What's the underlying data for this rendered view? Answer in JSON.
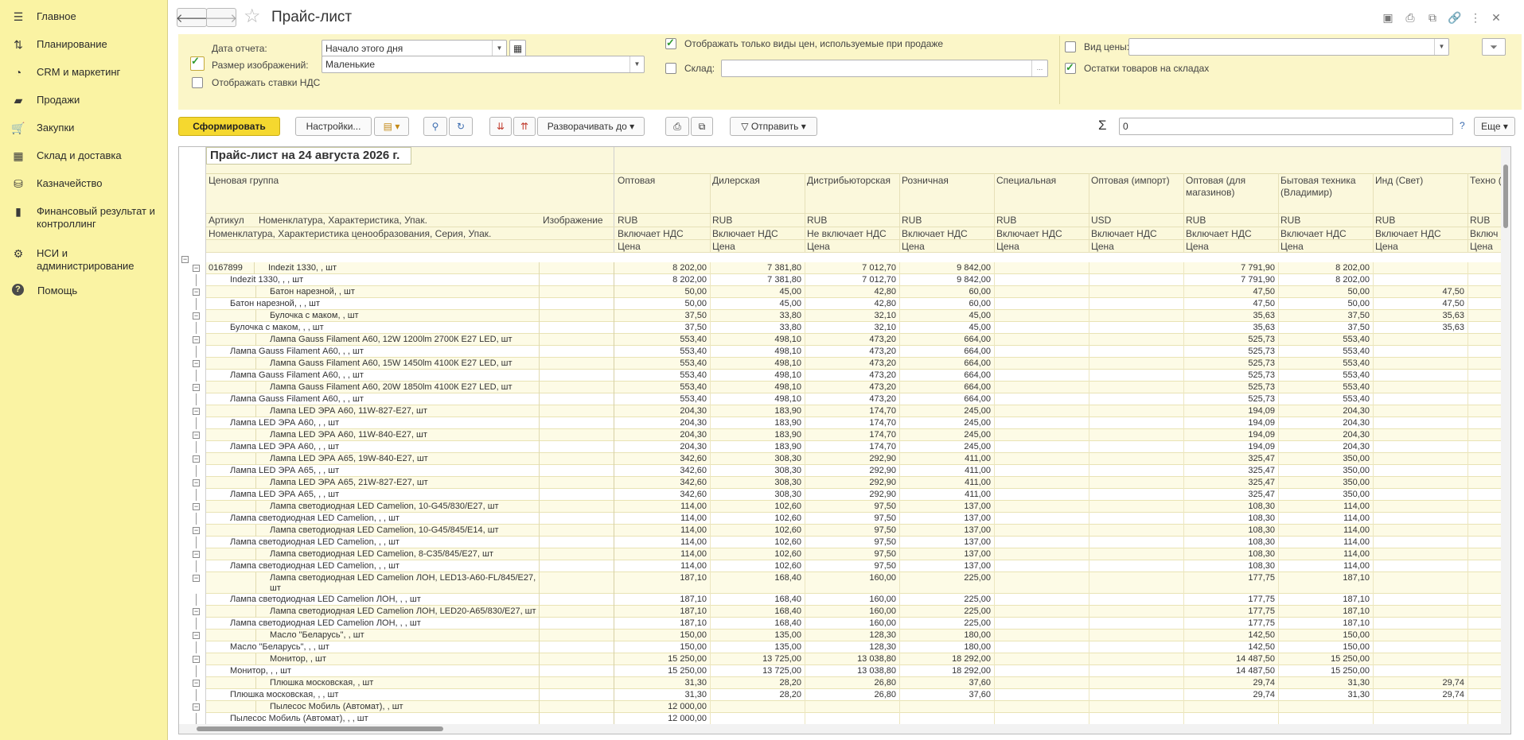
{
  "sidebar": {
    "items": [
      {
        "label": "Главное",
        "icon": "menu-icon"
      },
      {
        "label": "Планирование",
        "icon": "planning-icon"
      },
      {
        "label": "CRM и маркетинг",
        "icon": "crm-icon"
      },
      {
        "label": "Продажи",
        "icon": "bag-icon"
      },
      {
        "label": "Закупки",
        "icon": "cart-icon"
      },
      {
        "label": "Склад и доставка",
        "icon": "warehouse-icon"
      },
      {
        "label": "Казначейство",
        "icon": "treasury-icon"
      },
      {
        "label": "Финансовый результат и контроллинг",
        "icon": "chart-icon"
      },
      {
        "label": "НСИ и администрирование",
        "icon": "gear-icon"
      },
      {
        "label": "Помощь",
        "icon": "help-icon"
      }
    ]
  },
  "header": {
    "title": "Прайс-лист"
  },
  "filters": {
    "report_date_label": "Дата отчета:",
    "report_date_value": "Начало этого дня",
    "image_size_label": "Размер изображений:",
    "image_size_value": "Маленькие",
    "show_vat_label": "Отображать ставки НДС",
    "only_sale_prices_label": "Отображать только виды цен, используемые при продаже",
    "warehouse_label": "Склад:",
    "warehouse_value": "",
    "price_type_label": "Вид цены:",
    "price_type_value": "",
    "stock_label": "Остатки товаров на складах"
  },
  "toolbar": {
    "generate": "Сформировать",
    "settings": "Настройки...",
    "expand": "Разворачивать до",
    "send": "Отправить",
    "sum_value": "0",
    "help": "?",
    "more": "Еще"
  },
  "report": {
    "title": "Прайс-лист на 24 августа 2026 г.",
    "price_group_header": "Ценовая группа",
    "col_article": "Артикул",
    "col_nomenclature": "Номенклатура, Характеристика, Упак.",
    "col_image": "Изображение",
    "col_nomenclature2": "Номенклатура, Характеристика ценообразования, Серия, Упак.",
    "price_columns": [
      {
        "name": "Оптовая",
        "currency": "RUB",
        "vat": "Включает НДС",
        "kind": "Цена"
      },
      {
        "name": "Дилерская",
        "currency": "RUB",
        "vat": "Включает НДС",
        "kind": "Цена"
      },
      {
        "name": "Дистрибьюторская",
        "currency": "RUB",
        "vat": "Не включает НДС",
        "kind": "Цена"
      },
      {
        "name": "Розничная",
        "currency": "RUB",
        "vat": "Включает НДС",
        "kind": "Цена"
      },
      {
        "name": "Специальная",
        "currency": "RUB",
        "vat": "Включает НДС",
        "kind": "Цена"
      },
      {
        "name": "Оптовая (импорт)",
        "currency": "USD",
        "vat": "Включает НДС",
        "kind": "Цена"
      },
      {
        "name": "Оптовая (для магазинов)",
        "currency": "RUB",
        "vat": "Включает НДС",
        "kind": "Цена"
      },
      {
        "name": "Бытовая техника (Владимир)",
        "currency": "RUB",
        "vat": "Включает НДС",
        "kind": "Цена"
      },
      {
        "name": "Инд (Свет)",
        "currency": "RUB",
        "vat": "Включает НДС",
        "kind": "Цена"
      },
      {
        "name": "Техно (инди",
        "currency": "RUB",
        "vat": "Включ",
        "kind": "Цена"
      }
    ],
    "rows": [
      {
        "art": "0167899",
        "name": "Indezit 1330, , шт",
        "lvl": 1,
        "v": [
          "8 202,00",
          "7 381,80",
          "7 012,70",
          "9 842,00",
          "",
          "",
          "7 791,90",
          "8 202,00",
          "",
          ""
        ]
      },
      {
        "art": "",
        "name": "Indezit 1330, , , шт",
        "lvl": 0,
        "v": [
          "8 202,00",
          "7 381,80",
          "7 012,70",
          "9 842,00",
          "",
          "",
          "7 791,90",
          "8 202,00",
          "",
          ""
        ]
      },
      {
        "art": "",
        "name": "Батон нарезной, , шт",
        "lvl": 2,
        "v": [
          "50,00",
          "45,00",
          "42,80",
          "60,00",
          "",
          "",
          "47,50",
          "50,00",
          "47,50",
          ""
        ]
      },
      {
        "art": "",
        "name": "Батон нарезной, , , шт",
        "lvl": 0,
        "v": [
          "50,00",
          "45,00",
          "42,80",
          "60,00",
          "",
          "",
          "47,50",
          "50,00",
          "47,50",
          ""
        ]
      },
      {
        "art": "",
        "name": "Булочка с маком, , шт",
        "lvl": 2,
        "v": [
          "37,50",
          "33,80",
          "32,10",
          "45,00",
          "",
          "",
          "35,63",
          "37,50",
          "35,63",
          ""
        ]
      },
      {
        "art": "",
        "name": "Булочка с маком, , , шт",
        "lvl": 0,
        "v": [
          "37,50",
          "33,80",
          "32,10",
          "45,00",
          "",
          "",
          "35,63",
          "37,50",
          "35,63",
          ""
        ]
      },
      {
        "art": "",
        "name": "Лампа Gauss Filament А60, 12W 1200lm 2700К E27 LED, шт",
        "lvl": 2,
        "v": [
          "553,40",
          "498,10",
          "473,20",
          "664,00",
          "",
          "",
          "525,73",
          "553,40",
          "",
          ""
        ]
      },
      {
        "art": "",
        "name": "Лампа Gauss Filament А60, , , шт",
        "lvl": 0,
        "v": [
          "553,40",
          "498,10",
          "473,20",
          "664,00",
          "",
          "",
          "525,73",
          "553,40",
          "",
          ""
        ]
      },
      {
        "art": "",
        "name": "Лампа Gauss Filament А60, 15W 1450lm 4100К E27 LED, шт",
        "lvl": 2,
        "v": [
          "553,40",
          "498,10",
          "473,20",
          "664,00",
          "",
          "",
          "525,73",
          "553,40",
          "",
          ""
        ]
      },
      {
        "art": "",
        "name": "Лампа Gauss Filament А60, , , шт",
        "lvl": 0,
        "v": [
          "553,40",
          "498,10",
          "473,20",
          "664,00",
          "",
          "",
          "525,73",
          "553,40",
          "",
          ""
        ]
      },
      {
        "art": "",
        "name": "Лампа Gauss Filament А60, 20W 1850lm 4100К E27 LED, шт",
        "lvl": 2,
        "v": [
          "553,40",
          "498,10",
          "473,20",
          "664,00",
          "",
          "",
          "525,73",
          "553,40",
          "",
          ""
        ]
      },
      {
        "art": "",
        "name": "Лампа Gauss Filament А60, , , шт",
        "lvl": 0,
        "v": [
          "553,40",
          "498,10",
          "473,20",
          "664,00",
          "",
          "",
          "525,73",
          "553,40",
          "",
          ""
        ]
      },
      {
        "art": "",
        "name": "Лампа LED ЭРА А60, 11W-827-E27, шт",
        "lvl": 2,
        "v": [
          "204,30",
          "183,90",
          "174,70",
          "245,00",
          "",
          "",
          "194,09",
          "204,30",
          "",
          ""
        ]
      },
      {
        "art": "",
        "name": "Лампа LED ЭРА А60, , , шт",
        "lvl": 0,
        "v": [
          "204,30",
          "183,90",
          "174,70",
          "245,00",
          "",
          "",
          "194,09",
          "204,30",
          "",
          ""
        ]
      },
      {
        "art": "",
        "name": "Лампа LED ЭРА А60, 11W-840-E27, шт",
        "lvl": 2,
        "v": [
          "204,30",
          "183,90",
          "174,70",
          "245,00",
          "",
          "",
          "194,09",
          "204,30",
          "",
          ""
        ]
      },
      {
        "art": "",
        "name": "Лампа LED ЭРА А60, , , шт",
        "lvl": 0,
        "v": [
          "204,30",
          "183,90",
          "174,70",
          "245,00",
          "",
          "",
          "194,09",
          "204,30",
          "",
          ""
        ]
      },
      {
        "art": "",
        "name": "Лампа LED ЭРА А65, 19W-840-E27, шт",
        "lvl": 2,
        "v": [
          "342,60",
          "308,30",
          "292,90",
          "411,00",
          "",
          "",
          "325,47",
          "350,00",
          "",
          ""
        ]
      },
      {
        "art": "",
        "name": "Лампа LED ЭРА А65, , , шт",
        "lvl": 0,
        "v": [
          "342,60",
          "308,30",
          "292,90",
          "411,00",
          "",
          "",
          "325,47",
          "350,00",
          "",
          ""
        ]
      },
      {
        "art": "",
        "name": "Лампа LED ЭРА А65, 21W-827-E27, шт",
        "lvl": 2,
        "v": [
          "342,60",
          "308,30",
          "292,90",
          "411,00",
          "",
          "",
          "325,47",
          "350,00",
          "",
          ""
        ]
      },
      {
        "art": "",
        "name": "Лампа LED ЭРА А65, , , шт",
        "lvl": 0,
        "v": [
          "342,60",
          "308,30",
          "292,90",
          "411,00",
          "",
          "",
          "325,47",
          "350,00",
          "",
          ""
        ]
      },
      {
        "art": "",
        "name": "Лампа светодиодная LED Camelion, 10-G45/830/E27, шт",
        "lvl": 2,
        "v": [
          "114,00",
          "102,60",
          "97,50",
          "137,00",
          "",
          "",
          "108,30",
          "114,00",
          "",
          ""
        ]
      },
      {
        "art": "",
        "name": "Лампа светодиодная LED Camelion, , , шт",
        "lvl": 0,
        "v": [
          "114,00",
          "102,60",
          "97,50",
          "137,00",
          "",
          "",
          "108,30",
          "114,00",
          "",
          ""
        ]
      },
      {
        "art": "",
        "name": "Лампа светодиодная LED Camelion, 10-G45/845/E14, шт",
        "lvl": 2,
        "v": [
          "114,00",
          "102,60",
          "97,50",
          "137,00",
          "",
          "",
          "108,30",
          "114,00",
          "",
          ""
        ]
      },
      {
        "art": "",
        "name": "Лампа светодиодная LED Camelion, , , шт",
        "lvl": 0,
        "v": [
          "114,00",
          "102,60",
          "97,50",
          "137,00",
          "",
          "",
          "108,30",
          "114,00",
          "",
          ""
        ]
      },
      {
        "art": "",
        "name": "Лампа светодиодная LED Camelion, 8-C35/845/E27, шт",
        "lvl": 2,
        "v": [
          "114,00",
          "102,60",
          "97,50",
          "137,00",
          "",
          "",
          "108,30",
          "114,00",
          "",
          ""
        ]
      },
      {
        "art": "",
        "name": "Лампа светодиодная LED Camelion, , , шт",
        "lvl": 0,
        "v": [
          "114,00",
          "102,60",
          "97,50",
          "137,00",
          "",
          "",
          "108,30",
          "114,00",
          "",
          ""
        ]
      },
      {
        "art": "",
        "name": "Лампа светодиодная LED Camelion ЛОН, LED13-A60-FL/845/E27,",
        "name2": "шт",
        "lvl": 2,
        "v": [
          "187,10",
          "168,40",
          "160,00",
          "225,00",
          "",
          "",
          "177,75",
          "187,10",
          "",
          ""
        ]
      },
      {
        "art": "",
        "name": "Лампа светодиодная LED Camelion ЛОН, , , шт",
        "lvl": 0,
        "v": [
          "187,10",
          "168,40",
          "160,00",
          "225,00",
          "",
          "",
          "177,75",
          "187,10",
          "",
          ""
        ]
      },
      {
        "art": "",
        "name": "Лампа светодиодная LED Camelion ЛОН, LED20-A65/830/E27, шт",
        "lvl": 2,
        "v": [
          "187,10",
          "168,40",
          "160,00",
          "225,00",
          "",
          "",
          "177,75",
          "187,10",
          "",
          ""
        ]
      },
      {
        "art": "",
        "name": "Лампа светодиодная LED Camelion ЛОН, , , шт",
        "lvl": 0,
        "v": [
          "187,10",
          "168,40",
          "160,00",
          "225,00",
          "",
          "",
          "177,75",
          "187,10",
          "",
          ""
        ]
      },
      {
        "art": "",
        "name": "Масло \"Беларусь\", , шт",
        "lvl": 2,
        "v": [
          "150,00",
          "135,00",
          "128,30",
          "180,00",
          "",
          "",
          "142,50",
          "150,00",
          "",
          ""
        ]
      },
      {
        "art": "",
        "name": "Масло \"Беларусь\", , , шт",
        "lvl": 0,
        "v": [
          "150,00",
          "135,00",
          "128,30",
          "180,00",
          "",
          "",
          "142,50",
          "150,00",
          "",
          ""
        ]
      },
      {
        "art": "",
        "name": "Монитор, , шт",
        "lvl": 2,
        "v": [
          "15 250,00",
          "13 725,00",
          "13 038,80",
          "18 292,00",
          "",
          "",
          "14 487,50",
          "15 250,00",
          "",
          ""
        ]
      },
      {
        "art": "",
        "name": "Монитор, , , шт",
        "lvl": 0,
        "v": [
          "15 250,00",
          "13 725,00",
          "13 038,80",
          "18 292,00",
          "",
          "",
          "14 487,50",
          "15 250,00",
          "",
          ""
        ]
      },
      {
        "art": "",
        "name": "Плюшка московская, , шт",
        "lvl": 2,
        "v": [
          "31,30",
          "28,20",
          "26,80",
          "37,60",
          "",
          "",
          "29,74",
          "31,30",
          "29,74",
          ""
        ]
      },
      {
        "art": "",
        "name": "Плюшка московская, , , шт",
        "lvl": 0,
        "v": [
          "31,30",
          "28,20",
          "26,80",
          "37,60",
          "",
          "",
          "29,74",
          "31,30",
          "29,74",
          ""
        ]
      },
      {
        "art": "",
        "name": "Пылесос Мобиль (Автомат), , шт",
        "lvl": 2,
        "v": [
          "12 000,00",
          "",
          "",
          "",
          "",
          "",
          "",
          "",
          "",
          ""
        ]
      },
      {
        "art": "",
        "name": "Пылесос Мобиль (Автомат), , , шт",
        "lvl": 0,
        "v": [
          "12 000,00",
          "",
          "",
          "",
          "",
          "",
          "",
          "",
          "",
          ""
        ]
      }
    ]
  }
}
